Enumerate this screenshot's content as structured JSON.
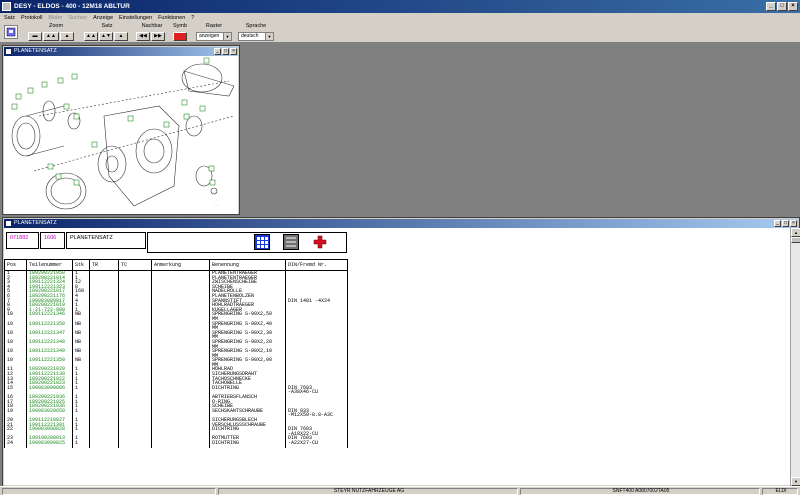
{
  "app": {
    "title": "DESY - ELDOS - 400 - 12M18 ABLTUR"
  },
  "menu": [
    {
      "label": "Satz",
      "disabled": false
    },
    {
      "label": "Protokoll",
      "disabled": false
    },
    {
      "label": "Bilder",
      "disabled": true
    },
    {
      "label": "Suchen",
      "disabled": true
    },
    {
      "label": "Anzeige",
      "disabled": false
    },
    {
      "label": "Einstellungen",
      "disabled": false
    },
    {
      "label": "Funktionen",
      "disabled": false
    },
    {
      "label": "?",
      "disabled": false
    }
  ],
  "toolbar": {
    "zoom_label": "Zoom",
    "satz_label": "Satz",
    "nachbar_label": "Nachbar",
    "symb_label": "Symb",
    "raster_label": "Raster",
    "sprache_label": "Sprache",
    "raster_value": "anzeigen",
    "sprache_value": "deutsch"
  },
  "drawing_window": {
    "title": "PLANETENSATZ"
  },
  "parts_window": {
    "title": "PLANETENSATZ",
    "code1": "071882",
    "code2": "1606",
    "name": "PLANETENSATZ"
  },
  "table": {
    "headers": [
      "Pos",
      "Teilenummer",
      "Stk",
      "TR",
      "TC",
      "Anmerkung",
      "Benennung",
      "DIN/Fremd Nr."
    ],
    "rows": [
      [
        "1",
        "189200221950",
        "1",
        "",
        "",
        "",
        "PLANETENTRAEGER",
        ""
      ],
      [
        "2",
        "189200221014",
        "1",
        "",
        "",
        "",
        "PLANETENTRAEGER",
        ""
      ],
      [
        "3",
        "199112221324",
        "12",
        "",
        "",
        "",
        "ZWISCHENSCHEIBE",
        ""
      ],
      [
        "4",
        "199112221323",
        "8",
        "",
        "",
        "",
        "SCHEIBE",
        ""
      ],
      [
        "5",
        "189200221017",
        "168",
        "",
        "",
        "",
        "NADELROLLE",
        ""
      ],
      [
        "6",
        "189200221176",
        "4",
        "",
        "",
        "",
        "PLANETENBOLZEN",
        ""
      ],
      [
        "7",
        "190003089017",
        "4",
        "",
        "",
        "",
        "SPANNSTIFT",
        "DIN 1481 -4X24"
      ],
      [
        "8",
        "189200221019",
        "1",
        "",
        "",
        "",
        "HOHLRADTRAEGER",
        ""
      ],
      [
        "9",
        "1-21-722-900",
        "1",
        "",
        "",
        "",
        "KUGELLAGER",
        ""
      ],
      [
        "10",
        "199112221346",
        "NB",
        "",
        "",
        "",
        "SPRENGRING S-90X2,50",
        ""
      ],
      [
        "",
        "",
        "",
        "",
        "",
        "",
        "MM",
        ""
      ],
      [
        "10",
        "199112221350",
        "NB",
        "",
        "",
        "",
        "SPRENGRING S-90X2,40",
        ""
      ],
      [
        "",
        "",
        "",
        "",
        "",
        "",
        "MM",
        ""
      ],
      [
        "10",
        "199112221347",
        "NB",
        "",
        "",
        "",
        "SPRENGRING S-90X2,30",
        ""
      ],
      [
        "",
        "",
        "",
        "",
        "",
        "",
        "MM",
        ""
      ],
      [
        "10",
        "199112221348",
        "NB",
        "",
        "",
        "",
        "SPRENGRING S-90X2,20",
        ""
      ],
      [
        "",
        "",
        "",
        "",
        "",
        "",
        "MM",
        ""
      ],
      [
        "10",
        "199112221349",
        "NB",
        "",
        "",
        "",
        "SPRENGRING S-90X2,10",
        ""
      ],
      [
        "",
        "",
        "",
        "",
        "",
        "",
        "MM",
        ""
      ],
      [
        "10",
        "199112221350",
        "NB",
        "",
        "",
        "",
        "SPRENGRING S-90X2,00",
        ""
      ],
      [
        "",
        "",
        "",
        "",
        "",
        "",
        "MM",
        ""
      ],
      [
        "11",
        "189200221020",
        "1",
        "",
        "",
        "",
        "HOHLRAD",
        ""
      ],
      [
        "12",
        "199112221130",
        "1",
        "",
        "",
        "",
        "SICHERUNGSDRAHT",
        ""
      ],
      [
        "13",
        "189200221022",
        "1",
        "",
        "",
        "",
        "TACHOSCHNECKE",
        ""
      ],
      [
        "14",
        "189200221023",
        "1",
        "",
        "",
        "",
        "TACHOWELLE",
        ""
      ],
      [
        "15",
        "190003090806",
        "1",
        "",
        "",
        "",
        "DICHTRING",
        "DIN 7603"
      ],
      [
        "",
        "",
        "",
        "",
        "",
        "",
        "",
        "-A38X46-CU"
      ],
      [
        "16",
        "189200221936",
        "1",
        "",
        "",
        "",
        "ABTRIEBSFLANSCH",
        ""
      ],
      [
        "17",
        "189200221025",
        "1",
        "",
        "",
        "",
        "O-RING",
        ""
      ],
      [
        "18",
        "189200221936",
        "1",
        "",
        "",
        "",
        "SCHEIBE",
        ""
      ],
      [
        "19",
        "190003020650",
        "1",
        "",
        "",
        "",
        "SECHSKANTSCHRAUBE",
        "DIN 933"
      ],
      [
        "",
        "",
        "",
        "",
        "",
        "",
        "",
        "-M12X50-8.8-A3C"
      ],
      [
        "20",
        "199112210827",
        "1",
        "",
        "",
        "",
        "SICHERUNGSBLECH",
        ""
      ],
      [
        "21",
        "199112221391",
        "1",
        "",
        "",
        "",
        "VERSCHLUSSSCHRAUBE",
        ""
      ],
      [
        "22",
        "190003090828",
        "1",
        "",
        "",
        "",
        "DICHTRING",
        "DIN 7603"
      ],
      [
        "",
        "",
        "",
        "",
        "",
        "",
        "",
        "-A18X22-CU"
      ],
      [
        "23",
        "199100200013",
        "1",
        "",
        "",
        "",
        "ROTMUTTER",
        "DIN 7603"
      ],
      [
        "24",
        "190003090825",
        "1",
        "",
        "",
        "",
        "DICHTRING",
        "-A22X27-CU"
      ]
    ]
  },
  "status": {
    "company": "STEYR NUTZFAHRZEUGE AG",
    "doc": "SNFT400 A0807002TA05",
    "lang": "ELDI"
  },
  "colors": {
    "code_magenta": "#c000c0",
    "partnumber_green": "#1a8a1a"
  }
}
